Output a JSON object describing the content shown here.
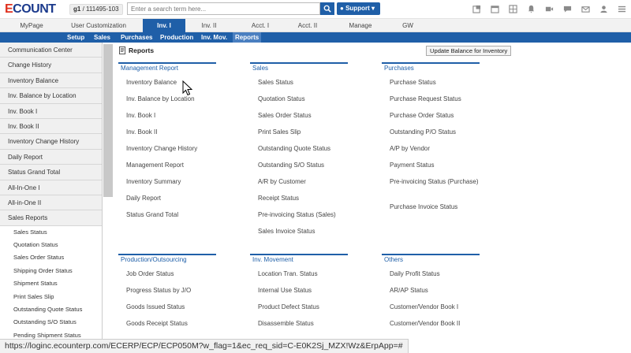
{
  "header": {
    "logo_e": "E",
    "logo_rest": "COUNT",
    "company_code": "g1",
    "company_id": "111495-103",
    "search_placeholder": "Enter a search term here...",
    "support_label": "Support ▾",
    "tools": [
      "new-window-icon",
      "calendar-icon",
      "grid-icon",
      "bell-icon",
      "video-icon",
      "chat-icon",
      "mail-icon",
      "user-icon",
      "menu-icon"
    ]
  },
  "main_tabs": [
    "MyPage",
    "User Customization",
    "Inv. I",
    "Inv. II",
    "Acct. I",
    "Acct. II",
    "Manage",
    "GW"
  ],
  "sub_tabs": [
    "Setup",
    "Sales",
    "Purchases",
    "Production",
    "Inv. Mov.",
    "Reports"
  ],
  "sidebar": {
    "items": [
      "Communication Center",
      "Change History",
      "Inventory Balance",
      "Inv. Balance by Location",
      "Inv. Book I",
      "Inv. Book II",
      "Inventory Change History",
      "Daily Report",
      "Status Grand Total",
      "All-In-One I",
      "All-in-One II",
      "Sales Reports"
    ],
    "sub_items": [
      "Sales Status",
      "Quotation Status",
      "Sales Order Status",
      "Shipping Order Status",
      "Shipment Status",
      "Print Sales Slip",
      "Outstanding Quote Status",
      "Outstanding S/O Status",
      "Pending Shipment Status"
    ]
  },
  "content": {
    "title": "Reports",
    "update_button": "Update Balance for Inventory",
    "sections": [
      {
        "title": "Management Report",
        "items": [
          "Inventory Balance",
          "Inv. Balance by Location",
          "Inv. Book I",
          "Inv. Book II",
          "Inventory Change History",
          "Management Report",
          "Inventory Summary",
          "Daily Report",
          "Status Grand Total"
        ]
      },
      {
        "title": "Sales",
        "items": [
          "Sales Status",
          "Quotation Status",
          "Sales Order Status",
          "Print Sales Slip",
          "Outstanding Quote Status",
          "Outstanding S/O Status",
          "A/R by Customer",
          "Receipt Status",
          "Pre-invoicing Status (Sales)",
          "Sales Invoice Status"
        ]
      },
      {
        "title": "Purchases",
        "items": [
          "Purchase Status",
          "Purchase Request Status",
          "Purchase Order Status",
          "Outstanding P/O Status",
          "A/P by Vendor",
          "Payment Status",
          "Pre-invoicing Status (Purchase)",
          "Purchase Invoice Status"
        ]
      },
      {
        "title": "Production/Outsourcing",
        "items": [
          "Job Order Status",
          "Progress Status by J/O",
          "Goods Issued Status",
          "Goods Receipt Status"
        ]
      },
      {
        "title": "Inv. Movement",
        "items": [
          "Location Tran. Status",
          "Internal Use Status",
          "Product Defect Status",
          "Disassemble Status"
        ]
      },
      {
        "title": "Others",
        "items": [
          "Daily Profit Status",
          "AR/AP Status",
          "Customer/Vendor Book I",
          "Customer/Vendor Book II"
        ]
      }
    ]
  },
  "status_url": "https://loginc.ecounterp.com/ECERP/ECP/ECP050M?w_flag=1&ec_req_sid=C-E0K2Sj_MZX!Wz&ErpApp=#",
  "colors": {
    "brand_blue": "#1f5fa8",
    "logo_red": "#e0301e"
  }
}
